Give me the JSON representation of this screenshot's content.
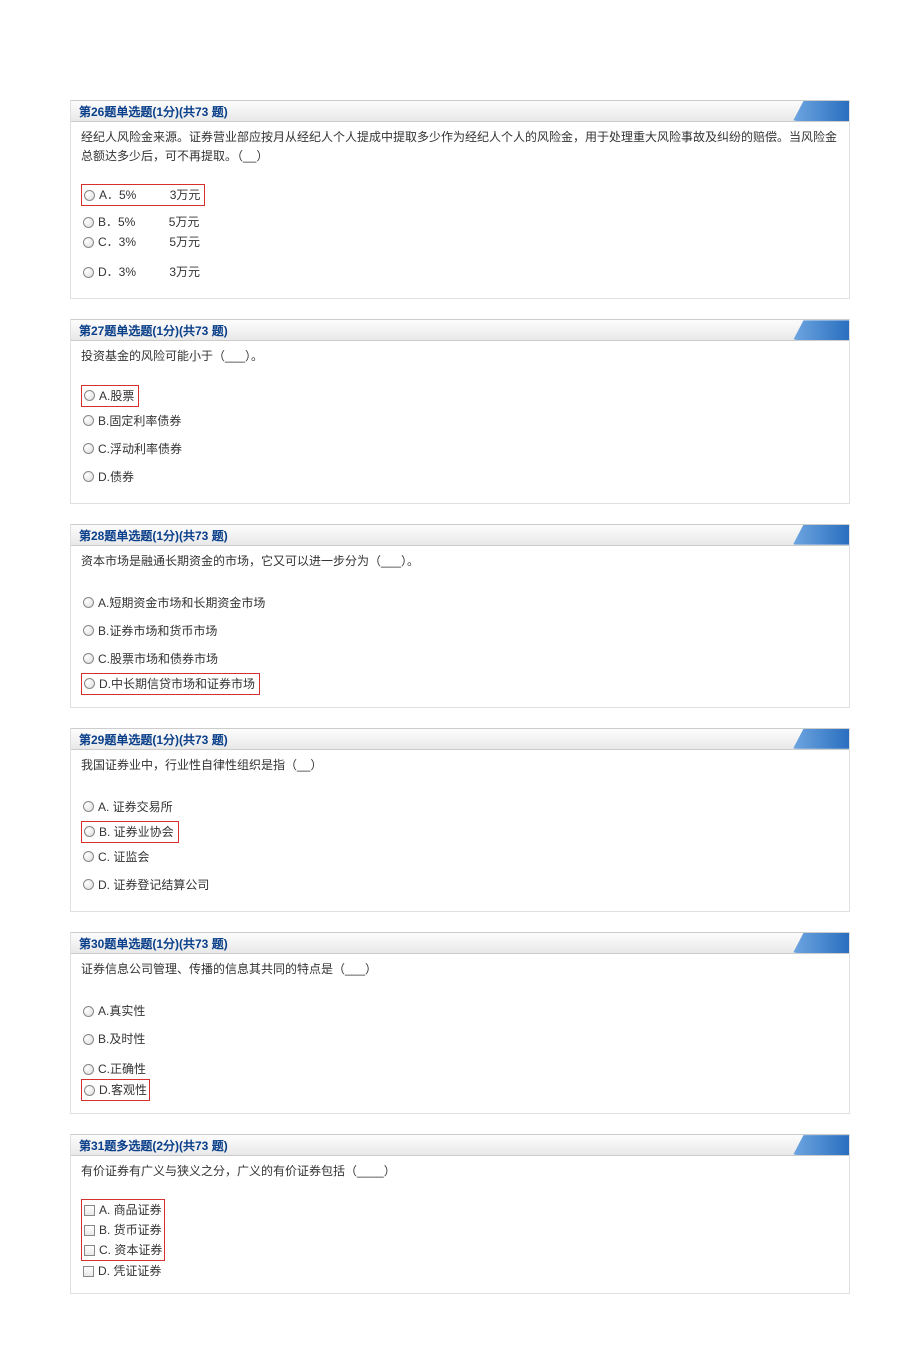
{
  "questions": [
    {
      "header": "第26题单选题(1分)(共73 题)",
      "text": "经纪人风险金来源。证券营业部应按月从经纪人个人提成中提取多少作为经纪人个人的风险金，用于处理重大风险事故及纠纷的赔偿。当风险金总额达多少后，可不再提取。（__）",
      "type": "radio",
      "options": [
        {
          "label": "A．5%          3万元",
          "highlighted": true,
          "tight": false
        },
        {
          "label": "B．5%          5万元",
          "highlighted": false,
          "tight": true,
          "group_after_spacer": true
        },
        {
          "label": "C．3%          5万元",
          "highlighted": false,
          "tight": true
        },
        {
          "label": "D．3%          3万元",
          "highlighted": false,
          "tight": false,
          "before_spacer": true
        }
      ]
    },
    {
      "header": "第27题单选题(1分)(共73 题)",
      "text": "投资基金的风险可能小于（___）。",
      "type": "radio",
      "options": [
        {
          "label": "A.股票",
          "highlighted": true
        },
        {
          "label": "B.固定利率债券",
          "highlighted": false
        },
        {
          "label": "C.浮动利率债券",
          "highlighted": false
        },
        {
          "label": "D.债券",
          "highlighted": false
        }
      ]
    },
    {
      "header": "第28题单选题(1分)(共73 题)",
      "text": "资本市场是融通长期资金的市场，它又可以进一步分为（___）。",
      "type": "radio",
      "options": [
        {
          "label": "A.短期资金市场和长期资金市场",
          "highlighted": false
        },
        {
          "label": "B.证券市场和货币市场",
          "highlighted": false
        },
        {
          "label": "C.股票市场和债券市场",
          "highlighted": false
        },
        {
          "label": "D.中长期信贷市场和证券市场",
          "highlighted": true
        }
      ]
    },
    {
      "header": "第29题单选题(1分)(共73 题)",
      "text": "我国证券业中，行业性自律性组织是指（__）",
      "type": "radio",
      "options": [
        {
          "label": "A. 证券交易所",
          "highlighted": false
        },
        {
          "label": "B. 证券业协会",
          "highlighted": true
        },
        {
          "label": "C. 证监会",
          "highlighted": false
        },
        {
          "label": "D. 证券登记结算公司",
          "highlighted": false
        }
      ]
    },
    {
      "header": "第30题单选题(1分)(共73 题)",
      "text": "证券信息公司管理、传播的信息其共同的特点是（___）",
      "type": "radio",
      "options": [
        {
          "label": "A.真实性",
          "highlighted": false
        },
        {
          "label": "B.及时性",
          "highlighted": false
        },
        {
          "label": "C.正确性",
          "highlighted": false,
          "tight": true,
          "before_spacer": true
        },
        {
          "label": "D.客观性",
          "highlighted": true,
          "tight": true
        }
      ]
    },
    {
      "header": "第31题多选题(2分)(共73 题)",
      "text": "有价证券有广义与狭义之分，广义的有价证券包括（____）",
      "type": "checkbox",
      "options": [
        {
          "label": "A. 商品证券",
          "highlighted": true,
          "tight": true
        },
        {
          "label": "B. 货币证券",
          "highlighted": true,
          "tight": true
        },
        {
          "label": "C. 资本证券",
          "highlighted": true,
          "tight": true
        },
        {
          "label": "D. 凭证证券",
          "highlighted": false,
          "tight": true
        }
      ],
      "group_highlight": true
    }
  ]
}
